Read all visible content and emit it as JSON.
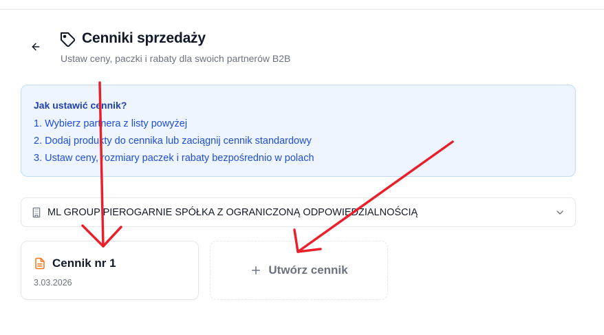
{
  "header": {
    "title": "Cenniki sprzedaży",
    "subtitle": "Ustaw ceny, paczki i rabaty dla swoich partnerów B2B",
    "back_icon": "arrow-left-icon",
    "title_icon": "tag-icon"
  },
  "info": {
    "title": "Jak ustawić cennik?",
    "steps": [
      "1. Wybierz partnera z listy powyżej",
      "2. Dodaj produkty do cennika lub zaciągnij cennik standardowy",
      "3. Ustaw ceny, rozmiary paczek i rabaty bezpośrednio w polach"
    ]
  },
  "partner_select": {
    "value": "ML GROUP PIEROGARNIE SPÓŁKA Z OGRANICZONĄ ODPOWIEDZIALNOŚCIĄ",
    "icon": "building-icon"
  },
  "pricelists": [
    {
      "title": "Cennik nr 1",
      "date": "3.03.2026",
      "icon": "document-icon"
    }
  ],
  "create_card": {
    "label": "Utwórz cennik",
    "icon": "plus-icon"
  },
  "colors": {
    "info_bg": "#eef5ff",
    "info_border": "#bfdbfe",
    "info_text": "#1d4ed8",
    "doc_icon": "#f97316",
    "annotation_arrow": "#e8202a"
  }
}
